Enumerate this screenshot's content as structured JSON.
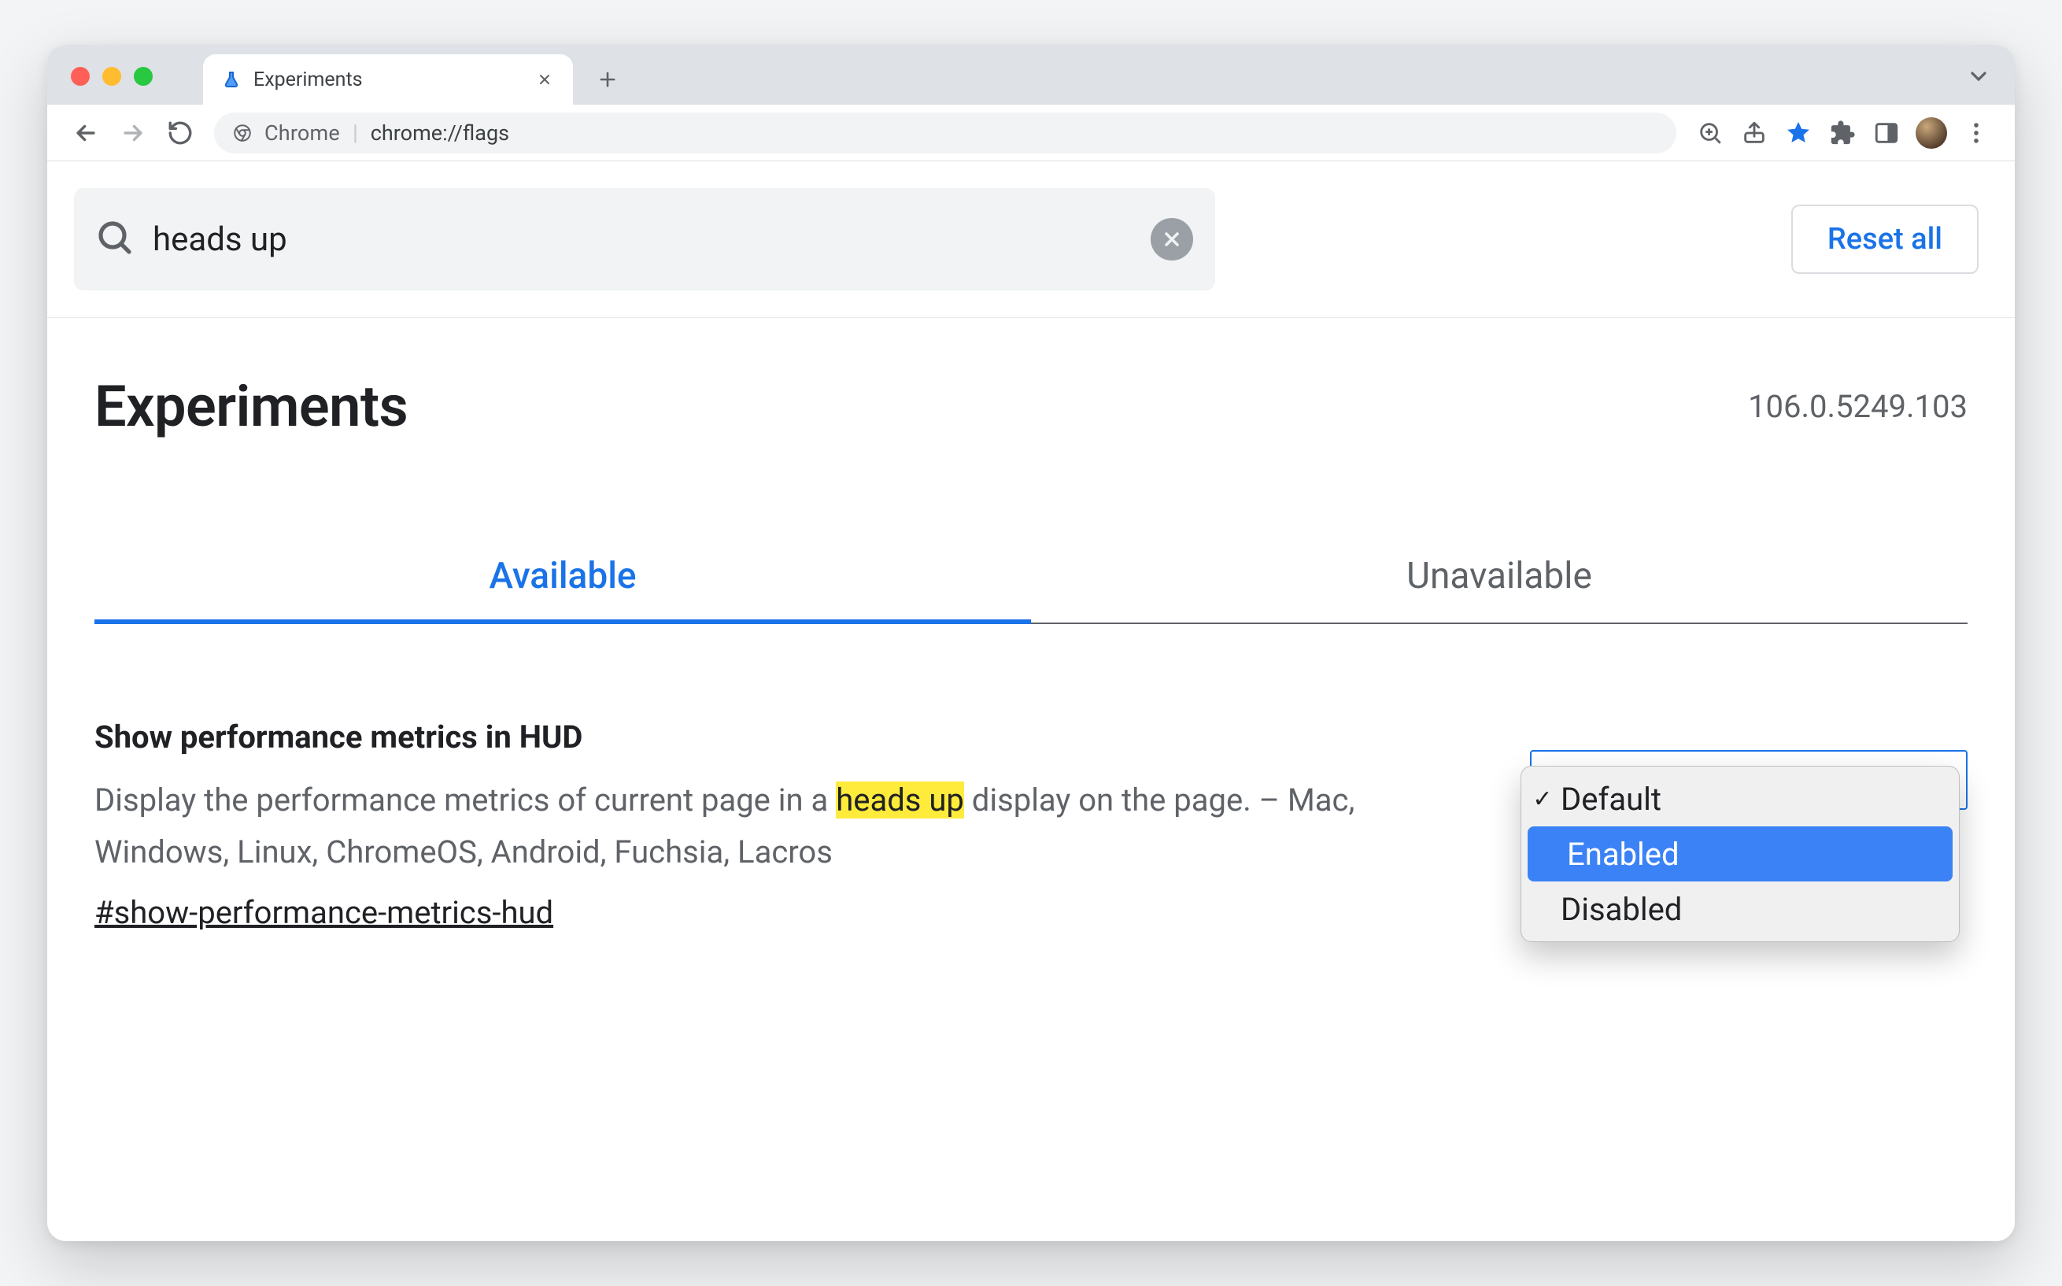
{
  "browser": {
    "tab_title": "Experiments",
    "url_prefix": "Chrome",
    "url_path": "chrome://flags"
  },
  "search": {
    "value": "heads up",
    "reset_label": "Reset all"
  },
  "page": {
    "title": "Experiments",
    "version": "106.0.5249.103"
  },
  "tabs": {
    "available": "Available",
    "unavailable": "Unavailable"
  },
  "flag": {
    "title": "Show performance metrics in HUD",
    "desc_pre": "Display the performance metrics of current page in a ",
    "desc_highlight": "heads up",
    "desc_post": " display on the page. – Mac, Windows, Linux, ChromeOS, Android, Fuchsia, Lacros",
    "hash": "#show-performance-metrics-hud",
    "options": {
      "default": "Default",
      "enabled": "Enabled",
      "disabled": "Disabled"
    }
  }
}
